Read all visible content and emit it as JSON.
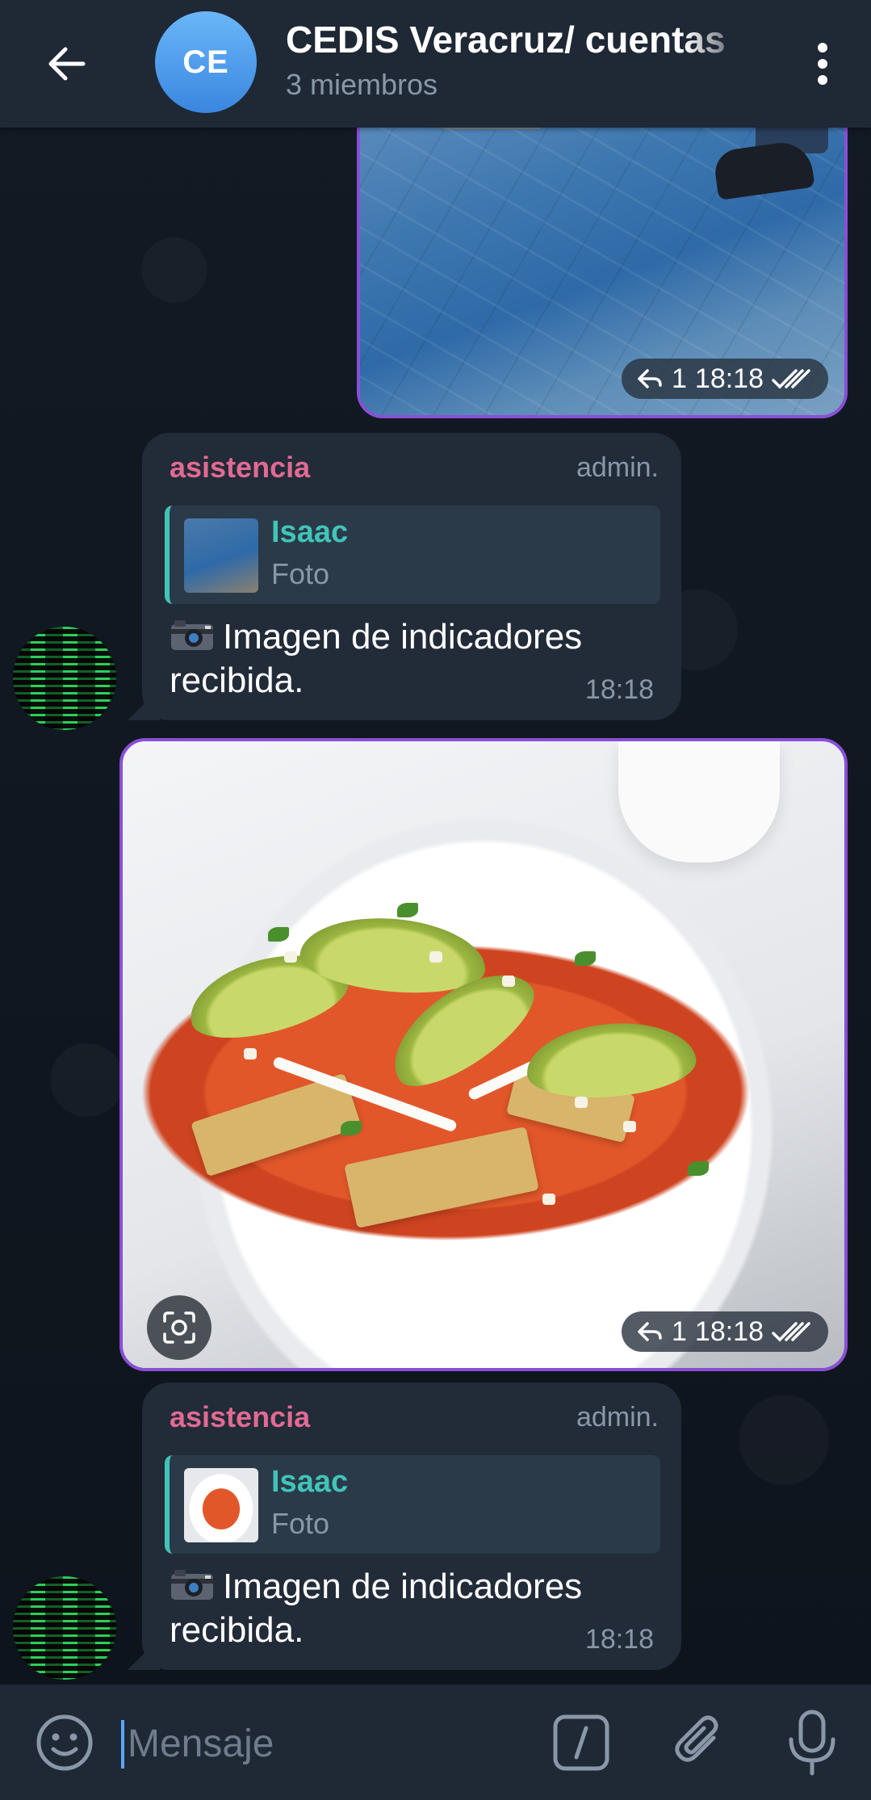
{
  "header": {
    "avatar_initials": "CE",
    "title": "CEDIS Veracruz/ cuentas",
    "subtitle": "3 miembros",
    "avatar_color": "#4a9cf0"
  },
  "messages": [
    {
      "type": "photo",
      "reply_count": "1",
      "time": "18:18",
      "read_status": "double-check-icon"
    },
    {
      "type": "text",
      "sender": "asistencia",
      "role": "admin.",
      "reply": {
        "name": "Isaac",
        "kind": "Foto"
      },
      "text": "Imagen de indicadores recibida.",
      "emoji": "camera-icon",
      "time": "18:18"
    },
    {
      "type": "photo",
      "reply_count": "1",
      "time": "18:18",
      "read_status": "double-check-icon"
    },
    {
      "type": "text",
      "sender": "asistencia",
      "role": "admin.",
      "reply": {
        "name": "Isaac",
        "kind": "Foto"
      },
      "text": "Imagen de indicadores recibida.",
      "emoji": "camera-icon",
      "time": "18:18"
    }
  ],
  "input": {
    "placeholder": "Mensaje"
  },
  "colors": {
    "accent": "#41c4b8",
    "sender": "#e26a93",
    "photo_border": "#8a4fd6"
  }
}
